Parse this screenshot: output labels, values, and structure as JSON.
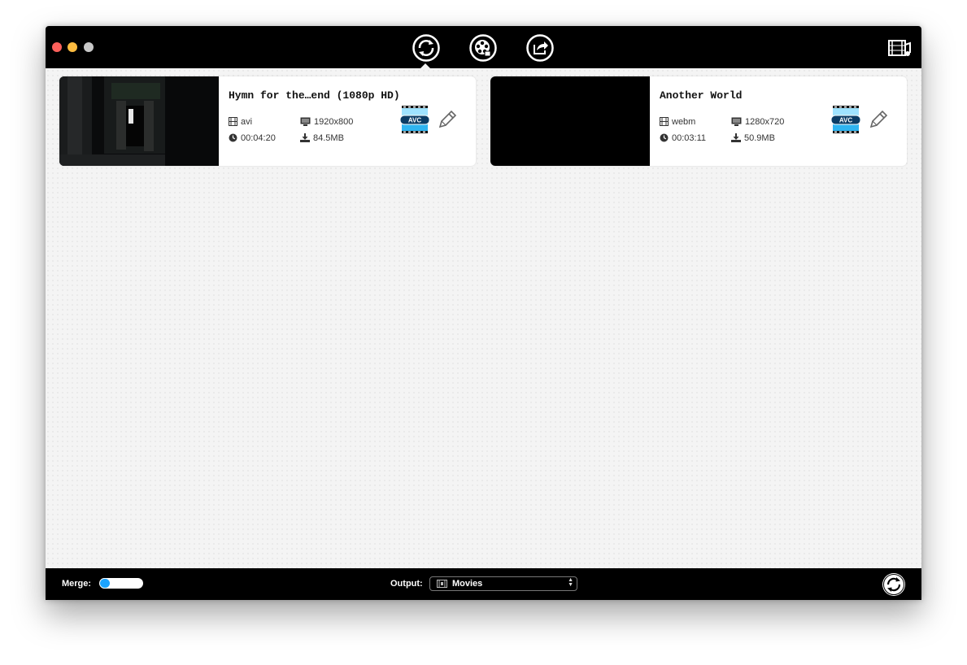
{
  "toolbar": {
    "tools": [
      {
        "icon": "convert-icon",
        "selected": true
      },
      {
        "icon": "reel-icon"
      },
      {
        "icon": "share-icon"
      }
    ],
    "right_icon": "media-library-icon"
  },
  "files": [
    {
      "title": "Hymn for the…end (1080p HD)",
      "format": "avi",
      "resolution": "1920x800",
      "duration": "00:04:20",
      "size": "84.5MB",
      "codec_label": "AVC"
    },
    {
      "title": "Another World",
      "format": "webm",
      "resolution": "1280x720",
      "duration": "00:03:11",
      "size": "50.9MB",
      "codec_label": "AVC"
    }
  ],
  "bottom": {
    "merge_label": "Merge:",
    "output_label": "Output:",
    "output_value": "Movies"
  },
  "colors": {
    "accent": "#1aa3ff",
    "bar": "#000000"
  }
}
